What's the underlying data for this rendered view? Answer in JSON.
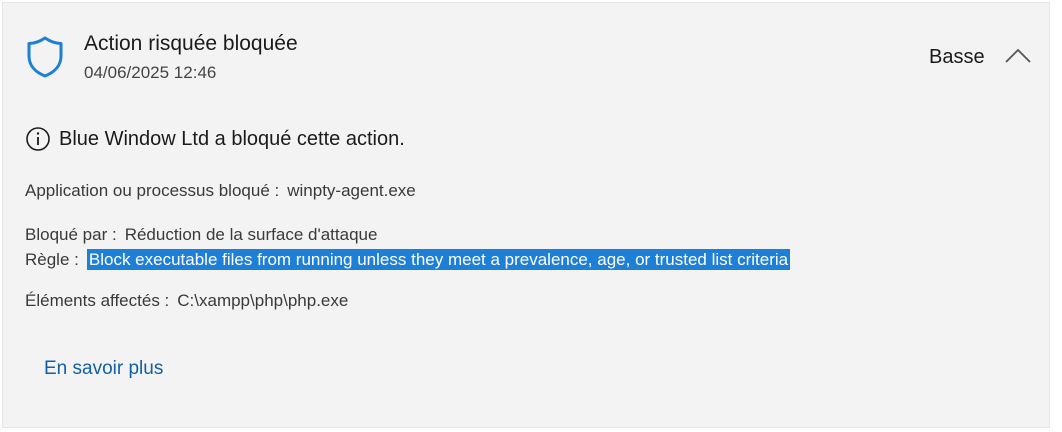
{
  "header": {
    "title": "Action risquée bloquée",
    "timestamp": "04/06/2025 12:46",
    "severity": "Basse",
    "icon": "shield-icon",
    "chevron_icon": "chevron-up-icon"
  },
  "info": {
    "icon": "info-icon",
    "message": "Blue Window Ltd a bloqué cette action."
  },
  "details": {
    "app_label": "Application ou processus bloqué :",
    "app_value": "winpty-agent.exe",
    "blocked_by_label": "Bloqué par :",
    "blocked_by_value": "Réduction de la surface d'attaque",
    "rule_label": "Règle :",
    "rule_value": "Block executable files from running unless they meet a prevalence, age, or trusted list criteria",
    "affected_label": "Éléments affectés :",
    "affected_value": "C:\\xampp\\php\\php.exe"
  },
  "actions": {
    "learn_more": "En savoir plus"
  },
  "colors": {
    "accent": "#1e7fd6",
    "link": "#1160a8",
    "card_bg": "#f3f3f3"
  }
}
